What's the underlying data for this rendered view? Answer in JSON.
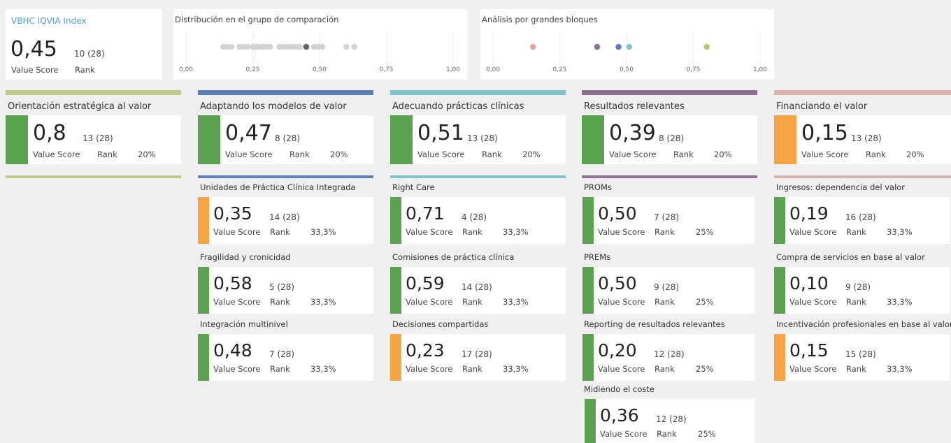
{
  "colors": {
    "green": "#5aa250",
    "orange": "#f5a543",
    "grey_dot": "#d3d3d3",
    "highlight_dot": "#5f6b6b",
    "olive": "#bfc98a",
    "blue": "#5e80b8",
    "teal": "#82c4c9",
    "purple": "#8e7191",
    "pink": "#d8b3ac"
  },
  "index": {
    "title": "VBHC IQVIA Index",
    "score": "0,45",
    "rank": "10 (28)",
    "value_label": "Value Score",
    "rank_label": "Rank"
  },
  "distribution": {
    "title": "Distribución en el grupo de comparación",
    "ticks": [
      "0,00",
      "0,25",
      "0,50",
      "0,75",
      "1,00"
    ],
    "points": [
      0.14,
      0.155,
      0.17,
      0.2,
      0.215,
      0.23,
      0.25,
      0.26,
      0.27,
      0.285,
      0.3,
      0.315,
      0.35,
      0.365,
      0.38,
      0.395,
      0.41,
      0.425,
      0.45,
      0.48,
      0.495,
      0.51,
      0.6,
      0.63
    ],
    "highlight": 0.45
  },
  "blocks": {
    "title": "Análisis por grandes bloques",
    "ticks": [
      "0,00",
      "0,25",
      "0,50",
      "0,75",
      "1,00"
    ],
    "points": [
      {
        "v": 0.15,
        "color": "#d8a9a0"
      },
      {
        "v": 0.39,
        "color": "#8e7191"
      },
      {
        "v": 0.47,
        "color": "#5e80b8"
      },
      {
        "v": 0.51,
        "color": "#82c4c9"
      },
      {
        "v": 0.8,
        "color": "#b9c475"
      }
    ]
  },
  "sections": [
    {
      "title": "Orientación estratégica al valor",
      "color": "#bfc98a",
      "score": "0,8",
      "rank": "13 (28)",
      "value_label": "Value Score",
      "rank_label": "Rank",
      "weight": "20%",
      "accent": "green",
      "items": []
    },
    {
      "title": "Adaptando los modelos de valor",
      "color": "#5e80b8",
      "score": "0,47",
      "rank": "8 (28)",
      "value_label": "Value Score",
      "rank_label": "Rank",
      "weight": "20%",
      "accent": "green",
      "items": [
        {
          "title": "Unidades de Práctica Clínica Integrada",
          "score": "0,35",
          "rank": "14 (28)",
          "value_label": "Value Score",
          "rank_label": "Rank",
          "weight": "33,3%",
          "accent": "orange"
        },
        {
          "title": "Fragilidad y cronicidad",
          "score": "0,58",
          "rank": "5 (28)",
          "value_label": "Value Score",
          "rank_label": "Rank",
          "weight": "33,3%",
          "accent": "green"
        },
        {
          "title": "Integración multinivel",
          "score": "0,48",
          "rank": "7 (28)",
          "value_label": "Value Score",
          "rank_label": "Rank",
          "weight": "33,3%",
          "accent": "green"
        }
      ]
    },
    {
      "title": "Adecuando prácticas clínicas",
      "color": "#82c4c9",
      "score": "0,51",
      "rank": "13 (28)",
      "value_label": "Value Score",
      "rank_label": "Rank",
      "weight": "20%",
      "accent": "green",
      "items": [
        {
          "title": "Right Care",
          "score": "0,71",
          "rank": "4 (28)",
          "value_label": "Value Score",
          "rank_label": "Rank",
          "weight": "33,3%",
          "accent": "green"
        },
        {
          "title": "Comisiones de práctica clínica",
          "score": "0,59",
          "rank": "14 (28)",
          "value_label": "Value Score",
          "rank_label": "Rank",
          "weight": "33,3%",
          "accent": "green"
        },
        {
          "title": "Decisiones compartidas",
          "score": "0,23",
          "rank": "17 (28)",
          "value_label": "Value Score",
          "rank_label": "Rank",
          "weight": "33,3%",
          "accent": "orange"
        }
      ]
    },
    {
      "title": "Resultados relevantes",
      "color": "#8e7191",
      "score": "0,39",
      "rank": "8 (28)",
      "value_label": "Value Score",
      "rank_label": "Rank",
      "weight": "20%",
      "accent": "green",
      "items": [
        {
          "title": "PROMs",
          "score": "0,50",
          "rank": "7 (28)",
          "value_label": "Value Score",
          "rank_label": "Rank",
          "weight": "25%",
          "accent": "green"
        },
        {
          "title": "PREMs",
          "score": "0,50",
          "rank": "9 (28)",
          "value_label": "Value Score",
          "rank_label": "Rank",
          "weight": "25%",
          "accent": "green"
        },
        {
          "title": "Reporting de resultados relevantes",
          "score": "0,20",
          "rank": "12 (28)",
          "value_label": "Value Score",
          "rank_label": "Rank",
          "weight": "25%",
          "accent": "green"
        },
        {
          "title": "Midiendo el coste",
          "score": "0,36",
          "rank": "12 (28)",
          "value_label": "Value Score",
          "rank_label": "Rank",
          "weight": "25%",
          "accent": "green"
        }
      ]
    },
    {
      "title": "Financiando el valor",
      "color": "#d8b3ac",
      "score": "0,15",
      "rank": "13 (28)",
      "value_label": "Value Score",
      "rank_label": "Rank",
      "weight": "20%",
      "accent": "orange",
      "items": [
        {
          "title": "Ingresos: dependencia del valor",
          "score": "0,19",
          "rank": "16 (28)",
          "value_label": "Value Score",
          "rank_label": "Rank",
          "weight": "33,3%",
          "accent": "green"
        },
        {
          "title": "Compra de servicios en base al valor",
          "score": "0,10",
          "rank": "9 (28)",
          "value_label": "Value Score",
          "rank_label": "Rank",
          "weight": "33,3%",
          "accent": "green"
        },
        {
          "title": "Incentivación profesionales en base al valor",
          "score": "0,15",
          "rank": "15 (28)",
          "value_label": "Value Score",
          "rank_label": "Rank",
          "weight": "33,3%",
          "accent": "orange"
        }
      ]
    }
  ]
}
